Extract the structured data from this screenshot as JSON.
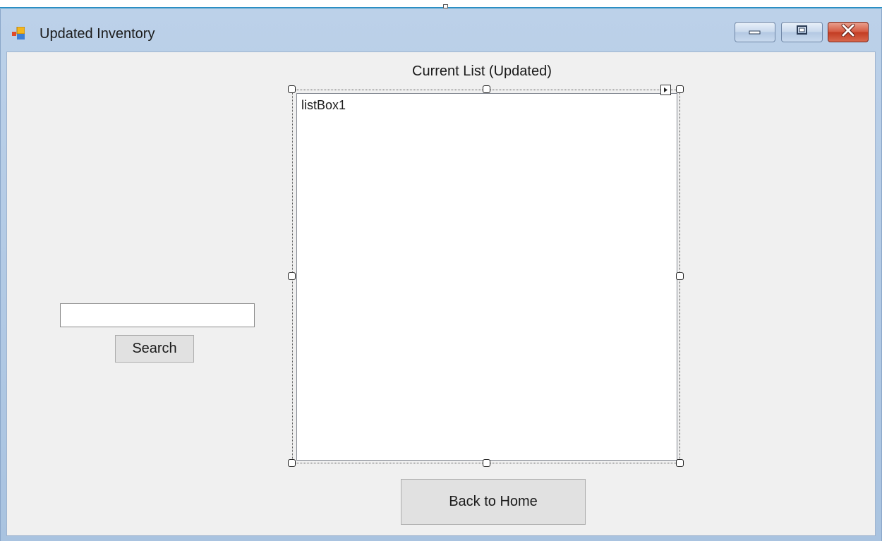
{
  "window": {
    "title": "Updated Inventory",
    "icon": "form-icon",
    "controls": [
      "minimize-icon",
      "maximize-icon",
      "close-icon"
    ]
  },
  "search": {
    "input_value": "",
    "button_label": "Search"
  },
  "list": {
    "label": "Current List (Updated)",
    "listbox_text": "listBox1"
  },
  "footer": {
    "back_button_label": "Back to Home"
  },
  "colors": {
    "title_bar": "#b9cfe8",
    "client_background": "#f0f0f0",
    "close_button": "#c9452c",
    "designer_accent": "#2b8fc4"
  }
}
